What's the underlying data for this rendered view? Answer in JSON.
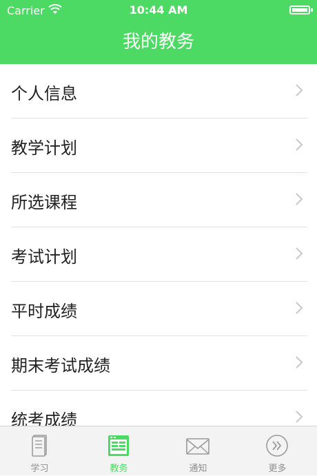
{
  "status_bar": {
    "carrier": "Carrier",
    "time": "10:44 AM"
  },
  "nav": {
    "title": "我的教务"
  },
  "menu": {
    "items": [
      {
        "label": "个人信息"
      },
      {
        "label": "教学计划"
      },
      {
        "label": "所选课程"
      },
      {
        "label": "考试计划"
      },
      {
        "label": "平时成绩"
      },
      {
        "label": "期末考试成绩"
      },
      {
        "label": "统考成绩"
      }
    ]
  },
  "tabbar": {
    "tabs": [
      {
        "label": "学习",
        "icon": "book-icon",
        "active": false
      },
      {
        "label": "教务",
        "icon": "schedule-icon",
        "active": true
      },
      {
        "label": "通知",
        "icon": "mail-icon",
        "active": false
      },
      {
        "label": "更多",
        "icon": "more-icon",
        "active": false
      }
    ]
  },
  "colors": {
    "accent": "#4cd964",
    "tab_inactive": "#8e8e8e"
  }
}
